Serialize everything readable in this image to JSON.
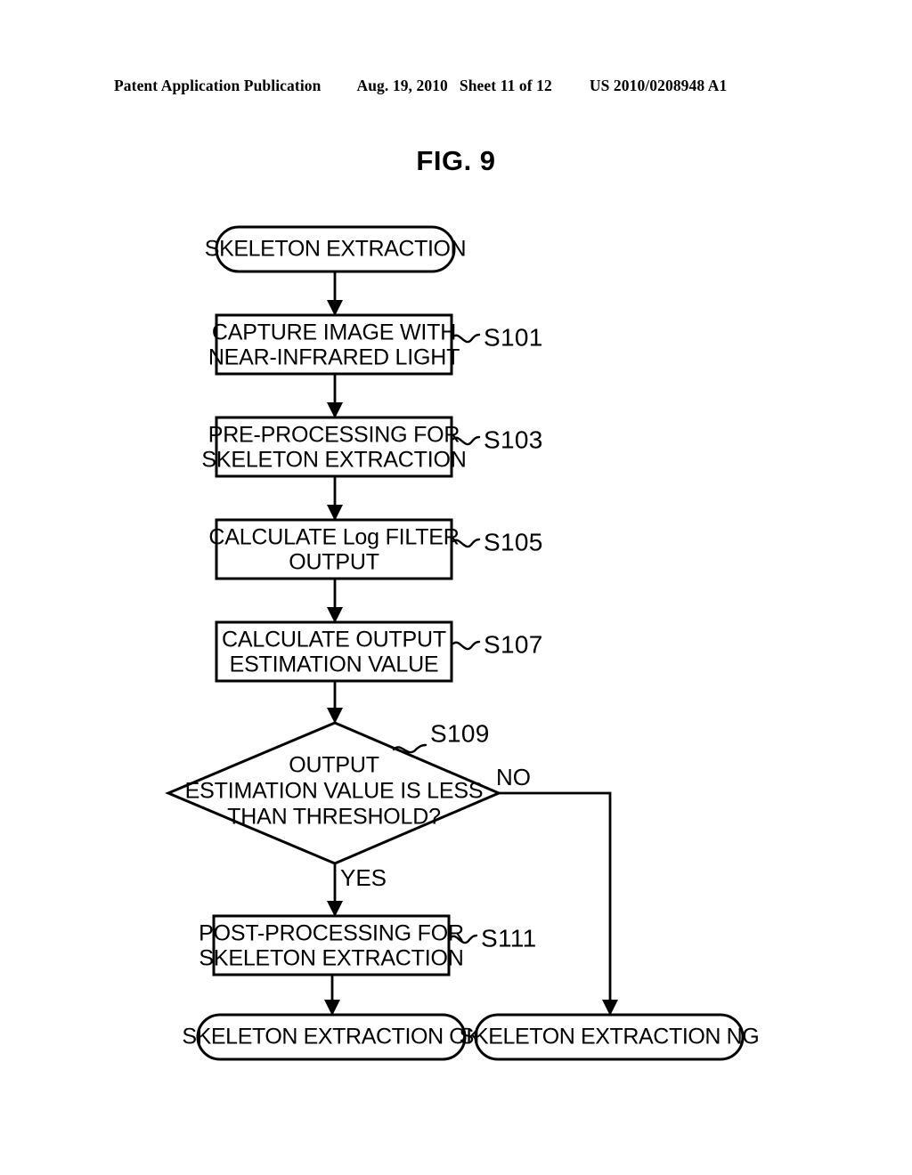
{
  "header": {
    "publication": "Patent Application Publication",
    "date": "Aug. 19, 2010",
    "sheet": "Sheet 11 of 12",
    "document_number": "US 2010/0208948 A1"
  },
  "figure": {
    "title": "FIG. 9"
  },
  "flowchart": {
    "start": {
      "label": "SKELETON EXTRACTION"
    },
    "steps": [
      {
        "id": "s101",
        "line1": "CAPTURE IMAGE WITH",
        "line2": "NEAR-INFRARED LIGHT",
        "step_number": "S101"
      },
      {
        "id": "s103",
        "line1": "PRE-PROCESSING FOR",
        "line2": "SKELETON EXTRACTION",
        "step_number": "S103"
      },
      {
        "id": "s105",
        "line1": "CALCULATE Log FILTER",
        "line2": "OUTPUT",
        "step_number": "S105"
      },
      {
        "id": "s107",
        "line1": "CALCULATE OUTPUT",
        "line2": "ESTIMATION VALUE",
        "step_number": "S107"
      }
    ],
    "decision": {
      "id": "s109",
      "line1": "OUTPUT",
      "line2": "ESTIMATION VALUE IS LESS",
      "line3": "THAN THRESHOLD?",
      "step_number": "S109",
      "yes_label": "YES",
      "no_label": "NO"
    },
    "post_step": {
      "id": "s111",
      "line1": "POST-PROCESSING FOR",
      "line2": "SKELETON EXTRACTION",
      "step_number": "S111"
    },
    "end_ok": {
      "label": "SKELETON EXTRACTION OK"
    },
    "end_ng": {
      "label": "SKELETON EXTRACTION NG"
    }
  },
  "colors": {
    "ink": "#000000",
    "paper": "#ffffff"
  }
}
